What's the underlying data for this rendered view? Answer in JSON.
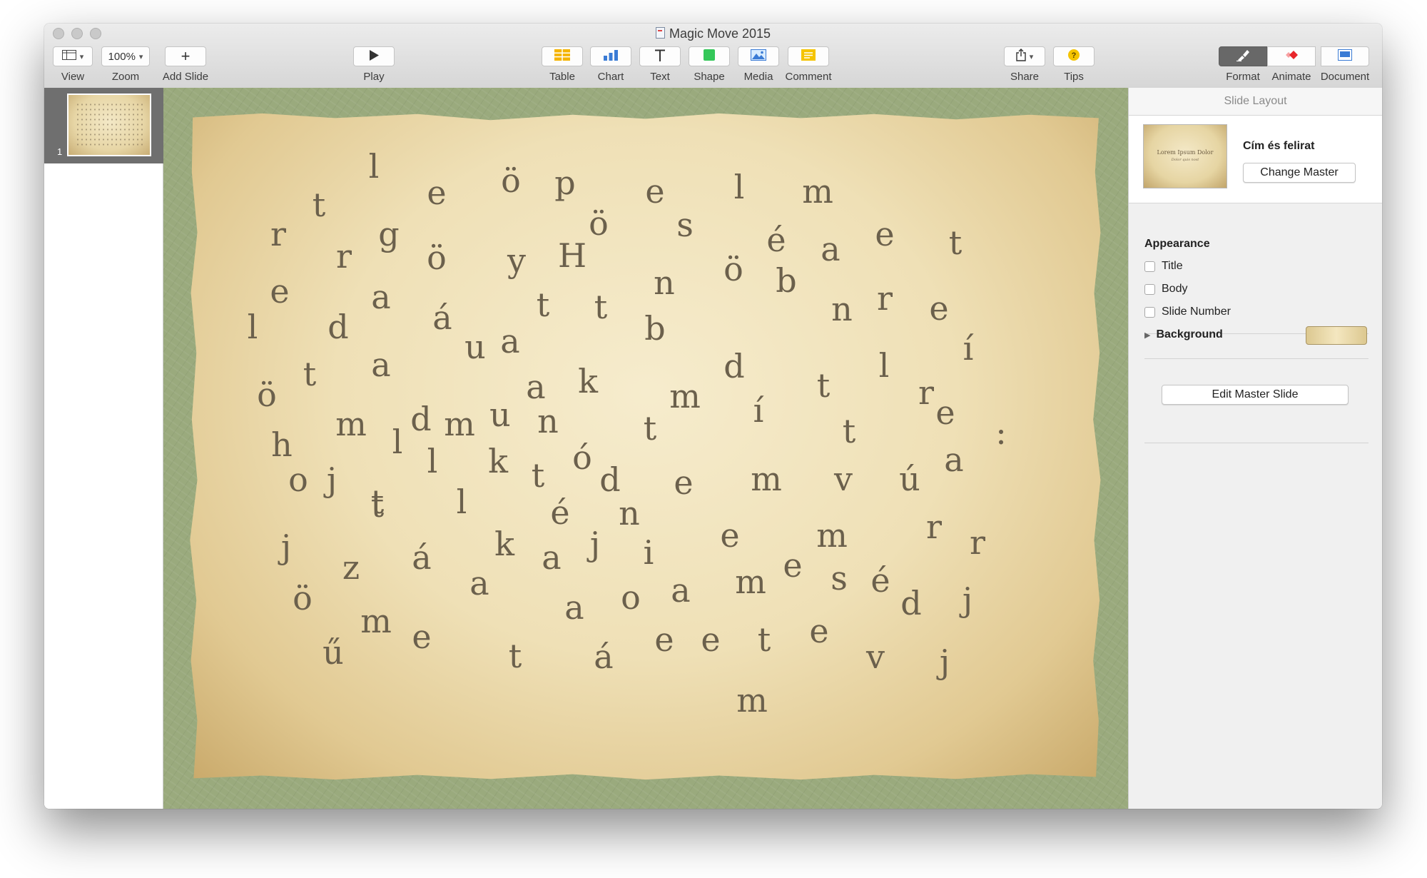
{
  "window": {
    "title": "Magic Move 2015"
  },
  "toolbar": {
    "view": {
      "label": "View"
    },
    "zoom": {
      "label": "Zoom",
      "value": "100%"
    },
    "add_slide": {
      "label": "Add Slide"
    },
    "play": {
      "label": "Play"
    },
    "table": {
      "label": "Table"
    },
    "chart": {
      "label": "Chart"
    },
    "text": {
      "label": "Text"
    },
    "shape": {
      "label": "Shape"
    },
    "media": {
      "label": "Media"
    },
    "comment": {
      "label": "Comment"
    },
    "share": {
      "label": "Share"
    },
    "tips": {
      "label": "Tips"
    },
    "format": {
      "label": "Format"
    },
    "animate": {
      "label": "Animate"
    },
    "document": {
      "label": "Document"
    }
  },
  "navigator": {
    "slides": [
      {
        "number": "1"
      }
    ]
  },
  "slide": {
    "letters": [
      {
        "ch": "l"
      },
      {
        "ch": "e"
      },
      {
        "ch": "ö"
      },
      {
        "ch": "p"
      },
      {
        "ch": "e"
      },
      {
        "ch": "l"
      },
      {
        "ch": "m"
      },
      {
        "ch": "t"
      },
      {
        "ch": "r"
      },
      {
        "ch": "g"
      },
      {
        "ch": "r"
      },
      {
        "ch": "ö"
      },
      {
        "ch": "y"
      },
      {
        "ch": "H"
      },
      {
        "ch": "ö"
      },
      {
        "ch": "s"
      },
      {
        "ch": "é"
      },
      {
        "ch": "a"
      },
      {
        "ch": "e"
      },
      {
        "ch": "t"
      },
      {
        "ch": "e"
      },
      {
        "ch": "a"
      },
      {
        "ch": "n"
      },
      {
        "ch": "ö"
      },
      {
        "ch": "b"
      },
      {
        "ch": "l"
      },
      {
        "ch": "d"
      },
      {
        "ch": "á"
      },
      {
        "ch": "t"
      },
      {
        "ch": "t"
      },
      {
        "ch": "b"
      },
      {
        "ch": "n"
      },
      {
        "ch": "r"
      },
      {
        "ch": "e"
      },
      {
        "ch": "u"
      },
      {
        "ch": "a"
      },
      {
        "ch": "í"
      },
      {
        "ch": "ö"
      },
      {
        "ch": "t"
      },
      {
        "ch": "a"
      },
      {
        "ch": "d"
      },
      {
        "ch": "a"
      },
      {
        "ch": "k"
      },
      {
        "ch": "m"
      },
      {
        "ch": "d"
      },
      {
        "ch": "t"
      },
      {
        "ch": "l"
      },
      {
        "ch": "r"
      },
      {
        "ch": "e"
      },
      {
        "ch": "h"
      },
      {
        "ch": "m"
      },
      {
        "ch": "l"
      },
      {
        "ch": "m"
      },
      {
        "ch": "u"
      },
      {
        "ch": "n"
      },
      {
        "ch": "t"
      },
      {
        "ch": "í"
      },
      {
        "ch": "t"
      },
      {
        "ch": ":"
      },
      {
        "ch": "o"
      },
      {
        "ch": "j"
      },
      {
        "ch": "t"
      },
      {
        "ch": "l"
      },
      {
        "ch": "k"
      },
      {
        "ch": "t"
      },
      {
        "ch": "ó"
      },
      {
        "ch": "d"
      },
      {
        "ch": "e"
      },
      {
        "ch": "m"
      },
      {
        "ch": "v"
      },
      {
        "ch": "ú"
      },
      {
        "ch": "a"
      },
      {
        "ch": "t"
      },
      {
        "ch": "l"
      },
      {
        "ch": "é"
      },
      {
        "ch": "n"
      },
      {
        "ch": "j"
      },
      {
        "ch": "z"
      },
      {
        "ch": "á"
      },
      {
        "ch": "k"
      },
      {
        "ch": "a"
      },
      {
        "ch": "j"
      },
      {
        "ch": "i"
      },
      {
        "ch": "e"
      },
      {
        "ch": "m"
      },
      {
        "ch": "r"
      },
      {
        "ch": "r"
      },
      {
        "ch": "a"
      },
      {
        "ch": "m"
      },
      {
        "ch": "e"
      },
      {
        "ch": "s"
      },
      {
        "ch": "é"
      },
      {
        "ch": "ö"
      },
      {
        "ch": "a"
      },
      {
        "ch": "o"
      },
      {
        "ch": "a"
      },
      {
        "ch": "d"
      },
      {
        "ch": "j"
      },
      {
        "ch": "m"
      },
      {
        "ch": "ű"
      },
      {
        "ch": "e"
      },
      {
        "ch": "t"
      },
      {
        "ch": "á"
      },
      {
        "ch": "e"
      },
      {
        "ch": "e"
      },
      {
        "ch": "t"
      },
      {
        "ch": "e"
      },
      {
        "ch": "v"
      },
      {
        "ch": "j"
      },
      {
        "ch": "m"
      }
    ]
  },
  "inspector": {
    "header": "Slide Layout",
    "master": {
      "name": "Cím és felirat",
      "thumb_title": "Lorem Ipsum Dolor",
      "thumb_subtitle": "Dolor quis nost",
      "change_label": "Change Master"
    },
    "appearance": {
      "title": "Appearance",
      "options": [
        {
          "label": "Title",
          "checked": false
        },
        {
          "label": "Body",
          "checked": false
        },
        {
          "label": "Slide Number",
          "checked": false
        }
      ]
    },
    "background": {
      "label": "Background"
    },
    "edit_master_label": "Edit Master Slide"
  },
  "colors": {
    "canvas_bg": "#9aaa7d",
    "letter": "#6b604c",
    "selected_tool": "#686868",
    "animate_accent": "#e8262b",
    "document_accent": "#3a7bd5",
    "tips_accent": "#f5c400"
  }
}
